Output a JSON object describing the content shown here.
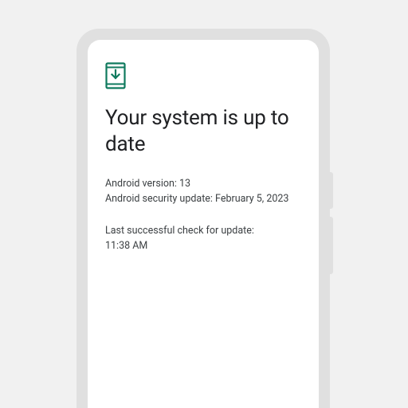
{
  "update": {
    "heading": "Your system is up to date",
    "android_version_line": "Android version: 13",
    "security_update_line": "Android security update: February 5, 2023",
    "last_check_label": "Last successful check for update:",
    "last_check_time": "11:38 AM"
  },
  "colors": {
    "icon": "#0f7a5e"
  }
}
